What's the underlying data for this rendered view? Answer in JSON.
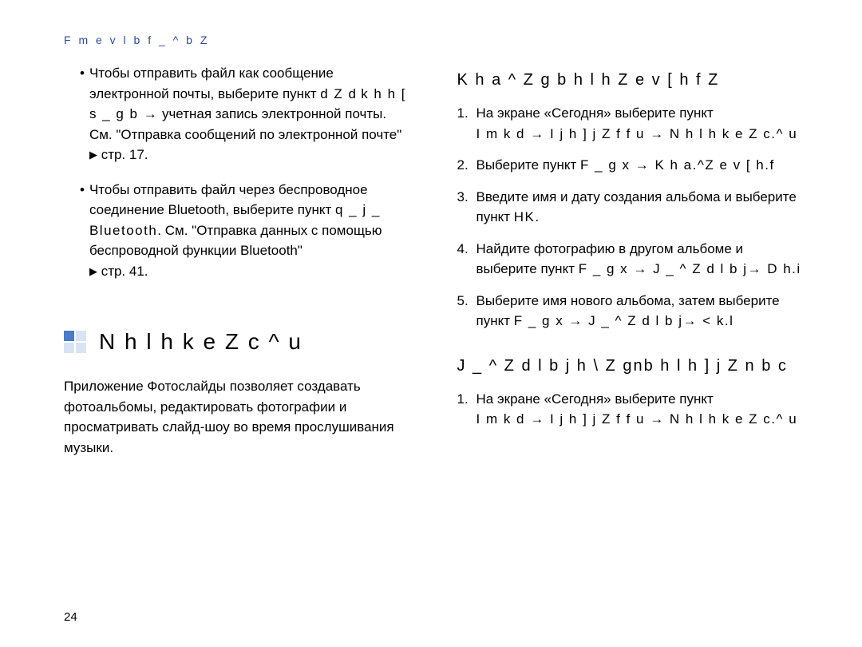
{
  "header": "F m e v l b f _ ^ b Z",
  "left": {
    "bullet1": {
      "l1": "Чтобы отправить файл как сообщение электронной почты, выберите пункт",
      "l2": "d Z d",
      "l3": "k h h [ s _ g b →",
      "l4": "учетная запись электронной почты. См. \"Отправка сообщений по электронной почте\"",
      "l5": "стр. 17."
    },
    "bullet2": {
      "l1": "Чтобы отправить файл через беспроводное соединение Bluetooth, выберите пункт",
      "l2": "q _ j _ Bluetooth",
      "l3": ". См. \"Отправка данных с помощью беспроводной функции Bluetooth\"",
      "l4": "стр. 41."
    },
    "section_title": "N h l h k e Z c ^ u",
    "intro": "Приложение Фотослайды позволяет создавать фотоальбомы, редактировать фотографии и просматривать слайд-шоу во время прослушивания музыки."
  },
  "right": {
    "sub1": "K h a ^ Z g b h l h Z e v [ h f Z",
    "step1a": "На экране «Сегодня» выберите пункт",
    "step1b": "I m k d → I j h ] j Z f f u  →  N h l h k e Z c.^ u",
    "step2a": "Выберите пункт",
    "step2b": "F _ g x → K h a.^Z e v [ h.f",
    "step3a": "Введите имя и дату создания альбома и выберите пункт",
    "step3b": "HK.",
    "step4a": "Найдите фотографию в другом альбоме и выберите пункт",
    "step4b": "F _ g x → J _ ^ Z d l b j→ D h.i",
    "step5a": "Выберите имя нового альбома, затем выберите пункт",
    "step5b": "F _ g x → J _ ^ Z d l b j→ < k.l",
    "sub2": "J _ ^ Z d l b j h \\ Z gnb h l h ] j Z n b c",
    "b_step1a": "На экране «Сегодня» выберите пункт",
    "b_step1b": "I m k d → I j h ] j Z f f u  →  N h l h k e Z c.^ u"
  },
  "pageno": "24"
}
